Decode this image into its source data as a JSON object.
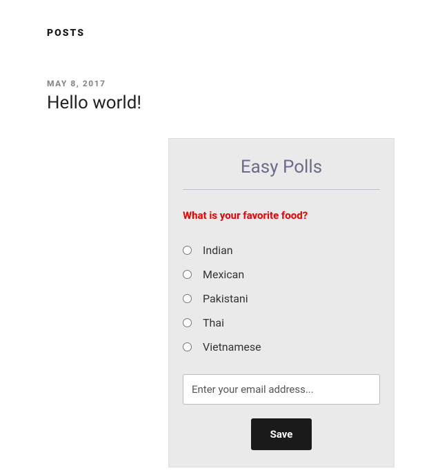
{
  "section_heading": "POSTS",
  "post": {
    "date": "MAY 8, 2017",
    "title": "Hello world!"
  },
  "poll": {
    "widget_title": "Easy Polls",
    "question": "What is your favorite food?",
    "options": [
      "Indian",
      "Mexican",
      "Pakistani",
      "Thai",
      "Vietnamese"
    ],
    "email_placeholder": "Enter your email address...",
    "save_label": "Save"
  }
}
